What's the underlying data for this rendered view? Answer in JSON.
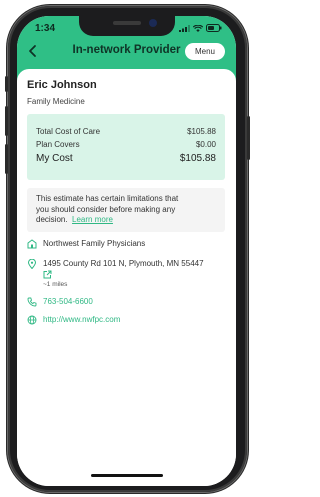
{
  "status_bar": {
    "time": "1:34"
  },
  "nav": {
    "title": "In-network Provider",
    "menu_label": "Menu"
  },
  "provider": {
    "name": "Eric Johnson",
    "specialty": "Family Medicine"
  },
  "cost": {
    "total_label": "Total Cost of Care",
    "total_value": "$105.88",
    "plan_label": "Plan Covers",
    "plan_value": "$0.00",
    "my_label": "My Cost",
    "my_value": "$105.88"
  },
  "note": {
    "line1": "This estimate has certain limitations that",
    "line2": "you should consider before making any",
    "line3": "decision.",
    "link": "Learn more"
  },
  "details": {
    "practice": "Northwest Family Physicians",
    "address": "1495 County Rd 101 N, Plymouth, MN 55447",
    "distance": "~1 miles",
    "phone": "763-504-6600",
    "website": "http://www.nwfpc.com"
  },
  "colors": {
    "accent": "#2fbf86",
    "card": "#d9f4e8",
    "note_bg": "#f4f4f4"
  }
}
